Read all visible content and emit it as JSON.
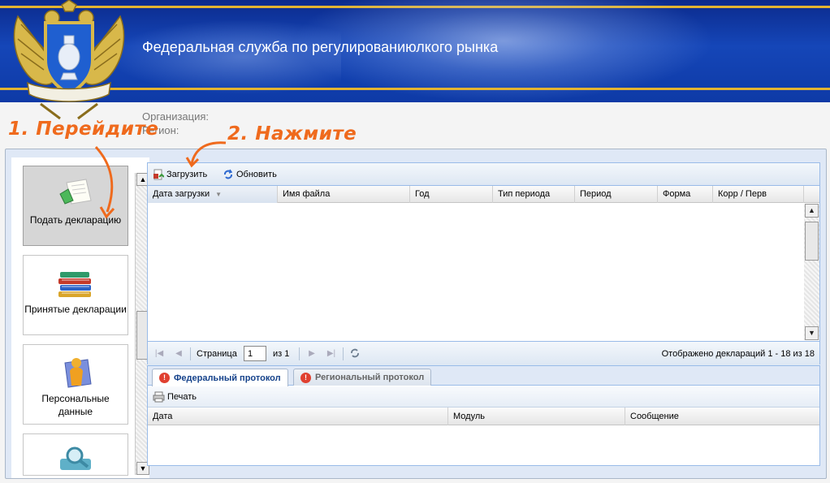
{
  "header": {
    "title": "Федеральная служба по регулированиюлкого рынка",
    "organization_label": "Организация:",
    "region_label": "Регион:"
  },
  "annotations": {
    "step1": "1. Перейдите",
    "step2": "2. Нажмите",
    "color": "#ef6a1d"
  },
  "sidebar": {
    "items": [
      {
        "label": "Подать декларацию",
        "icon": "document-submit-icon",
        "active": true
      },
      {
        "label": "Принятые декларации",
        "icon": "books-stack-icon",
        "active": false
      },
      {
        "label": "Персональные данные",
        "icon": "person-book-icon",
        "active": false
      },
      {
        "label": "",
        "icon": "search-magnifier-icon",
        "active": false
      }
    ]
  },
  "upload_grid": {
    "toolbar": {
      "upload_label": "Загрузить",
      "refresh_label": "Обновить"
    },
    "columns": [
      "Дата загрузки",
      "Имя файла",
      "Год",
      "Тип периода",
      "Период",
      "Форма",
      "Корр / Перв"
    ],
    "rows": [],
    "pager": {
      "page_label": "Страница",
      "page_value": "1",
      "of_label": "из 1",
      "summary": "Отображено деклараций 1 - 18 из 18"
    }
  },
  "protocol": {
    "tabs": [
      {
        "label": "Федеральный протокол",
        "active": true
      },
      {
        "label": "Региональный протокол",
        "active": false
      }
    ],
    "print_label": "Печать",
    "columns": [
      "Дата",
      "Модуль",
      "Сообщение"
    ]
  },
  "colors": {
    "banner": "#1546b8",
    "accent_gold": "#e3b431",
    "panel_border": "#99bbe8",
    "error_badge": "#e04030"
  }
}
